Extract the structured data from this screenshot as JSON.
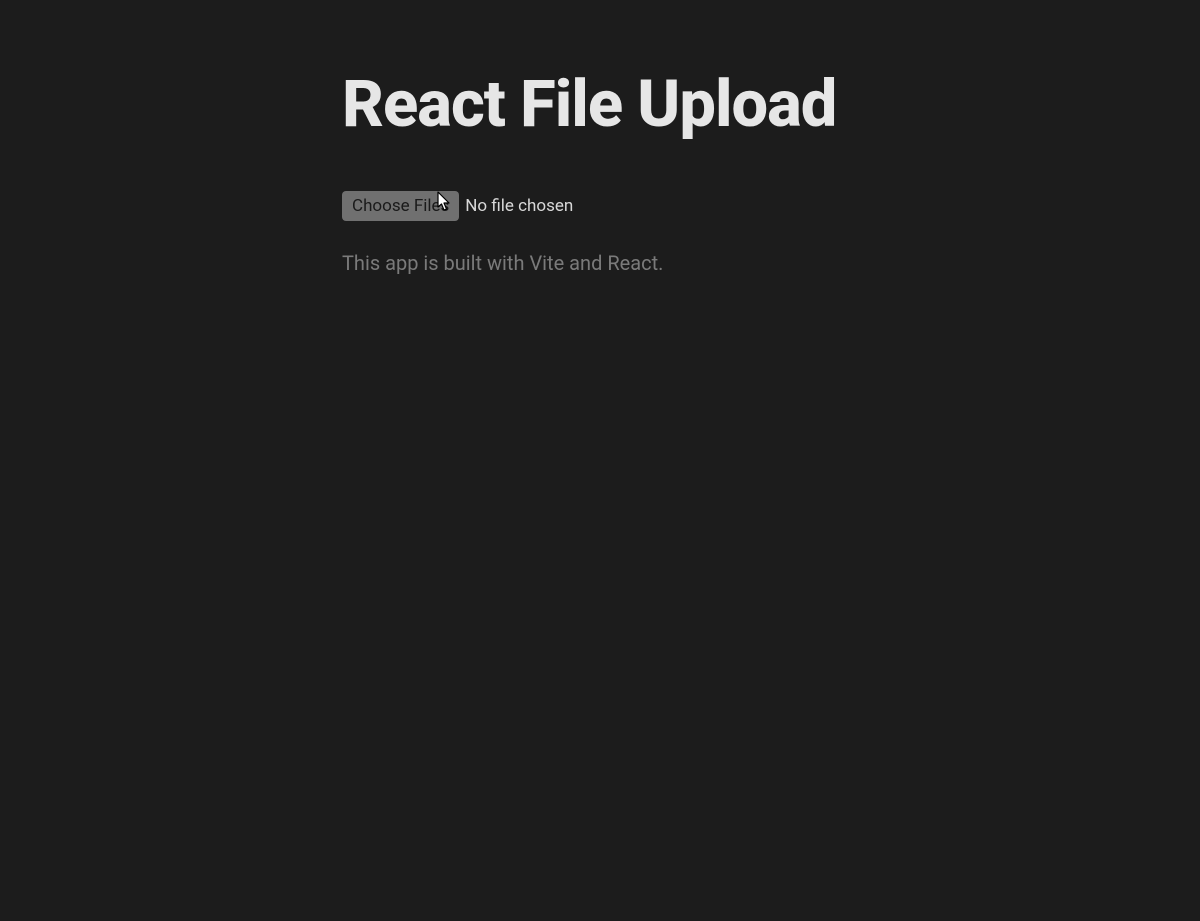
{
  "header": {
    "title": "React File Upload"
  },
  "fileInput": {
    "buttonLabel": "Choose Files",
    "statusText": "No file chosen"
  },
  "main": {
    "description": "This app is built with Vite and React."
  }
}
